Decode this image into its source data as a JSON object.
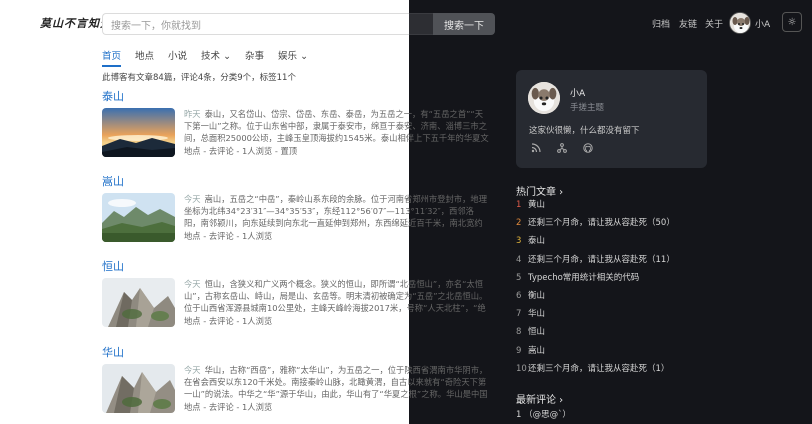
{
  "header": {
    "logo": "莫山不言知天",
    "search_placeholder": "搜索一下，你就找到",
    "search_button": "搜索一下",
    "nav": [
      "归档",
      "友链",
      "关于"
    ],
    "user": "小A",
    "theme_icon": "☼"
  },
  "categories": [
    {
      "label": "首页"
    },
    {
      "label": "地点"
    },
    {
      "label": "小说"
    },
    {
      "label": "技术 ⌄"
    },
    {
      "label": "杂事"
    },
    {
      "label": "娱乐 ⌄"
    }
  ],
  "stats": "此博客有文章84篇，评论4条，分类9个，标签11个",
  "posts": [
    {
      "title": "泰山",
      "day": "昨天",
      "excerpt": "泰山，又名岱山、岱宗、岱岳、东岳、泰岳，为五岳之一，有“五岳之首”“天下第一山”之称。位于山东省中部，隶属于泰安市，绵亘于泰安、济南、淄博三市之间，总面积25000公顷，主峰玉皇顶海拔约1545米。泰山相伴上下五千年的华夏文明传承历史，集国家兴盛...",
      "meta": "地点 - 去评论 - 1人浏览 - 置顶"
    },
    {
      "title": "嵩山",
      "day": "今天",
      "excerpt": "嵩山，五岳之“中岳”，秦岭山系东段的余脉。位于河南省郑州市登封市，地理坐标为北纬34°23′31″—34°35′53″，东经112°56′07″—113°11′32″，西邻洛阳，南邻颍川，向东延续到向东北一直延伸到郑州，东西绵延近百千米，南北宽约20千米。嵩山山系自西向东依...",
      "meta": "地点 - 去评论 - 1人浏览"
    },
    {
      "title": "恒山",
      "day": "今天",
      "excerpt": "恒山，含狭义和广义两个概念。狭义的恒山，即所谓“北岳恒山”，亦名“太恒山”，古称玄岳山、峙山，局是山、玄岳等。明末清初被确定为“五岳”之北岳恒山。位于山西省浑源县城南10公里处，主峰天峰岭海拔2017米，号称“人天北柱”，“绝塞名山”。广义的恒山，或称...",
      "meta": "地点 - 去评论 - 1人浏览"
    },
    {
      "title": "华山",
      "day": "今天",
      "excerpt": "华山，古称“西岳”，雅称“太华山”，为五岳之一，位于陕西省渭南市华阴市，在省会西安以东120千米处。南接秦岭山脉，北瞰黄渭，自古以来就有“奇险天下第一山”的说法。中华之“华”源于华山，由此，华山有了“华夏之根”之称。华山是中国道教主流全真派圣地，为”...",
      "meta": "地点 - 去评论 - 1人浏览"
    }
  ],
  "profile": {
    "name": "小A",
    "subtitle": "手搓主题",
    "description": "这家伙很懒，什么都没有留下",
    "icons": [
      "rss-icon",
      "sitemap-icon",
      "github-icon"
    ]
  },
  "hot_articles": {
    "title": "热门文章 ›",
    "items": [
      {
        "num": "1",
        "label": "黄山"
      },
      {
        "num": "2",
        "label": "还剩三个月命，请让我从容赴死（50）"
      },
      {
        "num": "3",
        "label": "泰山"
      },
      {
        "num": "4",
        "label": "还剩三个月命，请让我从容赴死（11）"
      },
      {
        "num": "5",
        "label": "Typecho常用统计相关的代码"
      },
      {
        "num": "6",
        "label": "衡山"
      },
      {
        "num": "7",
        "label": "华山"
      },
      {
        "num": "8",
        "label": "恒山"
      },
      {
        "num": "9",
        "label": "嵩山"
      },
      {
        "num": "10",
        "label": "还剩三个月命，请让我从容赴死（1）"
      }
    ]
  },
  "latest_comments": {
    "title": "最新评论 ›",
    "first": "1 （@思@`）"
  }
}
